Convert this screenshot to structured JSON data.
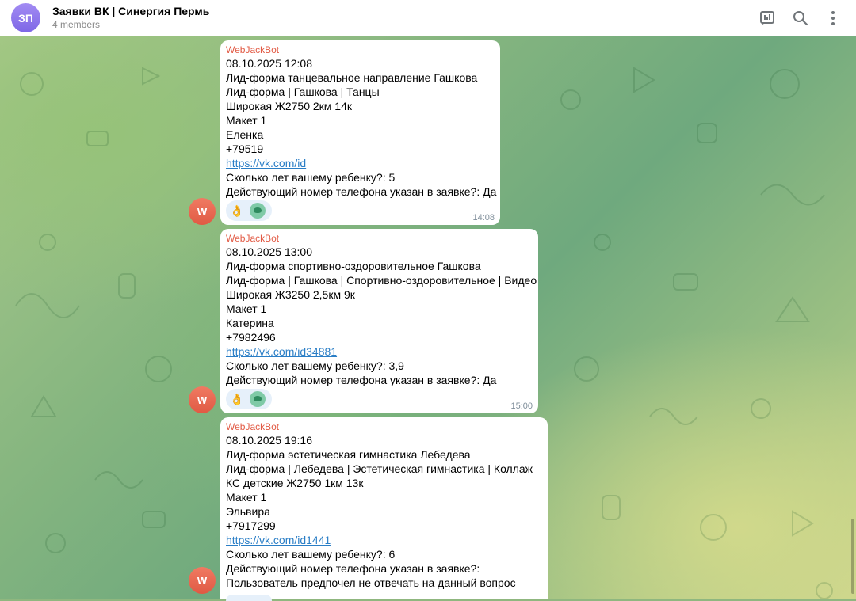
{
  "chat": {
    "avatar_initials": "ЗП",
    "title": "Заявки ВК | Синергия Пермь",
    "subtitle": "4 members"
  },
  "header_icons": [
    "poll-icon",
    "search-icon",
    "more-vertical-icon"
  ],
  "colors": {
    "sender": "#e25a44",
    "link": "#2a7ec6",
    "bubble": "#ffffff",
    "avatar_chat": "#8b74ee",
    "avatar_bot": "#e8654e"
  },
  "messages": [
    {
      "avatar": "W",
      "sender": "WebJackBot",
      "lines": [
        "08.10.2025 12:08",
        "Лид-форма танцевальное направление Гашкова",
        "Лид-форма | Гашкова | Танцы",
        "Широкая Ж2750 2км 14к",
        "Макет 1",
        "Еленка",
        "+79519"
      ],
      "link": "https://vk.com/id",
      "lines_after": [
        "Сколько лет вашему ребенку?: 5",
        "Действующий номер телефона указан в заявке?: Да"
      ],
      "reactions": [
        "👌",
        "green-logo"
      ],
      "time": "14:08"
    },
    {
      "avatar": "W",
      "sender": "WebJackBot",
      "lines": [
        "08.10.2025 13:00",
        "Лид-форма спортивно-оздоровительное Гашкова",
        "Лид-форма | Гашкова | Спортивно-оздоровительное | Видео",
        "Широкая Ж3250 2,5км 9к",
        "Макет 1",
        "Катерина",
        "+7982496"
      ],
      "link": "https://vk.com/id34881",
      "lines_after": [
        "Сколько лет вашему ребенку?: 3,9",
        "Действующий номер телефона указан в заявке?: Да"
      ],
      "reactions": [
        "👌",
        "green-logo"
      ],
      "time": "15:00"
    },
    {
      "avatar": "W",
      "sender": "WebJackBot",
      "lines": [
        "08.10.2025 19:16",
        "Лид-форма эстетическая гимнастика Лебедева",
        "Лид-форма | Лебедева | Эстетическая гимнастика | Коллаж",
        "КС детские Ж2750 1км 13к",
        "Макет 1",
        "Эльвира",
        "+7917299"
      ],
      "link": "https://vk.com/id1441",
      "lines_after": [
        "Сколько лет вашему ребенку?: 6",
        "Действующий номер телефона указан в заявке?:",
        "Пользователь предпочел не отвечать на данный вопрос"
      ]
    }
  ]
}
